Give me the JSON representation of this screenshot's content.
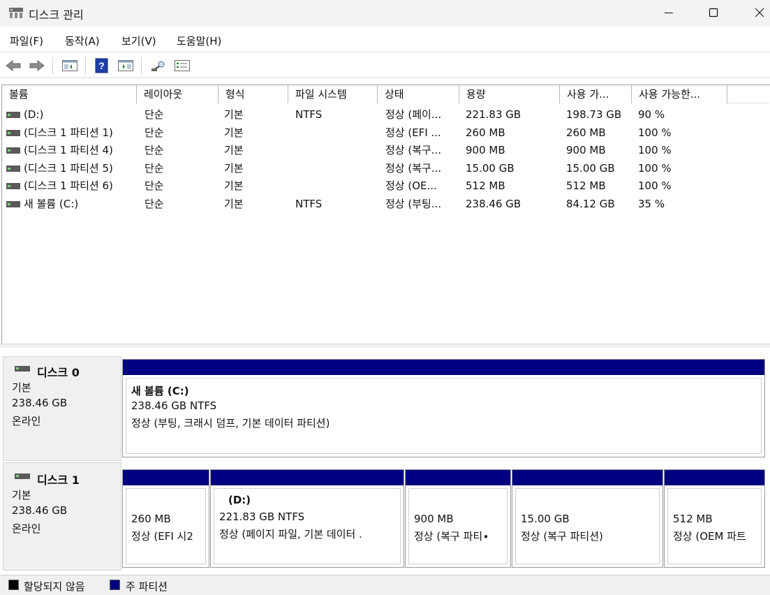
{
  "window": {
    "title": "디스크 관리",
    "icon": "disk-management-icon"
  },
  "menu": [
    {
      "label": "파일(F)"
    },
    {
      "label": "동작(A)"
    },
    {
      "label": "보기(V)"
    },
    {
      "label": "도움말(H)"
    }
  ],
  "toolbar": {
    "buttons": [
      "back-icon",
      "forward-icon",
      "show-hide-console-tree-icon",
      "help-icon",
      "show-hide-action-pane-icon",
      "rescan-disks-icon",
      "properties-icon"
    ]
  },
  "volume_list": {
    "columns": [
      "볼륨",
      "레이아웃",
      "형식",
      "파일 시스템",
      "상태",
      "용량",
      "사용 가...",
      "사용 가능한..."
    ],
    "rows": [
      {
        "volume": " (D:)",
        "layout": "단순",
        "type": "기본",
        "fs": "NTFS",
        "status": "정상 (페이...",
        "capacity": "221.83 GB",
        "free": "198.73 GB",
        "pct": "90 %"
      },
      {
        "volume": "(디스크 1 파티션 1)",
        "layout": "단순",
        "type": "기본",
        "fs": "",
        "status": "정상 (EFI ...",
        "capacity": "260 MB",
        "free": "260 MB",
        "pct": "100 %"
      },
      {
        "volume": "(디스크 1 파티션 4)",
        "layout": "단순",
        "type": "기본",
        "fs": "",
        "status": "정상 (복구...",
        "capacity": "900 MB",
        "free": "900 MB",
        "pct": "100 %"
      },
      {
        "volume": "(디스크 1 파티션 5)",
        "layout": "단순",
        "type": "기본",
        "fs": "",
        "status": "정상 (복구...",
        "capacity": "15.00 GB",
        "free": "15.00 GB",
        "pct": "100 %"
      },
      {
        "volume": "(디스크 1 파티션 6)",
        "layout": "단순",
        "type": "기본",
        "fs": "",
        "status": "정상 (OE...",
        "capacity": "512 MB",
        "free": "512 MB",
        "pct": "100 %"
      },
      {
        "volume": "새 볼륨 (C:)",
        "layout": "단순",
        "type": "기본",
        "fs": "NTFS",
        "status": "정상 (부팅...",
        "capacity": "238.46 GB",
        "free": "84.12 GB",
        "pct": "35 %"
      }
    ]
  },
  "disks": [
    {
      "name": "디스크 0",
      "kind": "기본",
      "size": "238.46 GB",
      "state": "온라인",
      "partitions": [
        {
          "title": "새 볼륨  (C:)",
          "line1": "238.46 GB NTFS",
          "line2": "정상 (부팅, 크래시 덤프, 기본 데이터 파티션)"
        }
      ]
    },
    {
      "name": "디스크 1",
      "kind": "기본",
      "size": "238.46 GB",
      "state": "온라인",
      "partitions": [
        {
          "title": "",
          "line1": "260 MB",
          "line2": "정상 (EFI 시2"
        },
        {
          "title": "(D:)",
          "line1": "221.83 GB NTFS",
          "line2": "정상 (페이지 파일, 기본 데이터 ."
        },
        {
          "title": "",
          "line1": "900 MB",
          "line2": "정상 (복구 파티∙"
        },
        {
          "title": "",
          "line1": "15.00 GB",
          "line2": "정상 (복구 파티션)"
        },
        {
          "title": "",
          "line1": "512 MB",
          "line2": "정상 (OEM 파트"
        }
      ]
    }
  ],
  "legend": [
    {
      "label": "할당되지 않음",
      "color": "#000000"
    },
    {
      "label": "주 파티션",
      "color": "#000080"
    }
  ],
  "colors": {
    "primary_partition": "#000080",
    "unallocated": "#000000"
  }
}
